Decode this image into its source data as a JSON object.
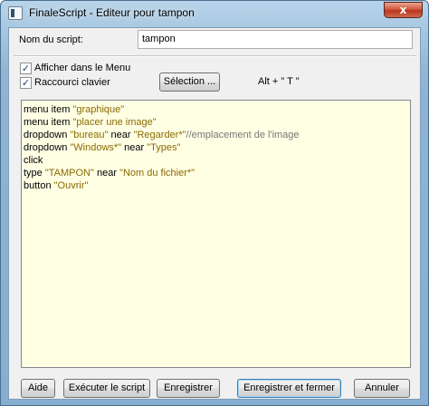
{
  "window": {
    "title": "FinaleScript - Editeur pour tampon",
    "close_glyph": "x"
  },
  "form": {
    "script_name_label": "Nom du script:",
    "script_name_value": "tampon",
    "show_in_menu_label": "Afficher dans le Menu",
    "show_in_menu_checked": true,
    "shortcut_label": "Raccourci clavier",
    "shortcut_checked": true,
    "selection_button": "Sélection ...",
    "shortcut_value": "Alt + \" T \""
  },
  "editor": {
    "lines": [
      [
        {
          "t": "menu item ",
          "c": "kw"
        },
        {
          "t": "\"graphique\"",
          "c": "str"
        }
      ],
      [
        {
          "t": "menu item ",
          "c": "kw"
        },
        {
          "t": "\"placer une image\"",
          "c": "str"
        }
      ],
      [
        {
          "t": "dropdown ",
          "c": "kw"
        },
        {
          "t": "\"bureau\"",
          "c": "str"
        },
        {
          "t": " near ",
          "c": "kw"
        },
        {
          "t": "\"Regarder*\"",
          "c": "str"
        },
        {
          "t": "//emplacement de l'image",
          "c": "cmt"
        }
      ],
      [
        {
          "t": "dropdown ",
          "c": "kw"
        },
        {
          "t": "\"Windows*\"",
          "c": "str"
        },
        {
          "t": " near ",
          "c": "kw"
        },
        {
          "t": "\"Types\"",
          "c": "str"
        }
      ],
      [
        {
          "t": "click",
          "c": "kw"
        }
      ],
      [
        {
          "t": "type ",
          "c": "kw"
        },
        {
          "t": "\"TAMPON\"",
          "c": "str"
        },
        {
          "t": " near ",
          "c": "kw"
        },
        {
          "t": "\"Nom du fichier*\"",
          "c": "str"
        }
      ],
      [
        {
          "t": "button ",
          "c": "kw"
        },
        {
          "t": "\"Ouvrir\"",
          "c": "str"
        }
      ]
    ]
  },
  "buttons": {
    "help": "Aide",
    "run": "Exécuter le script",
    "save": "Enregistrer",
    "save_close": "Enregistrer et fermer",
    "cancel": "Annuler"
  }
}
